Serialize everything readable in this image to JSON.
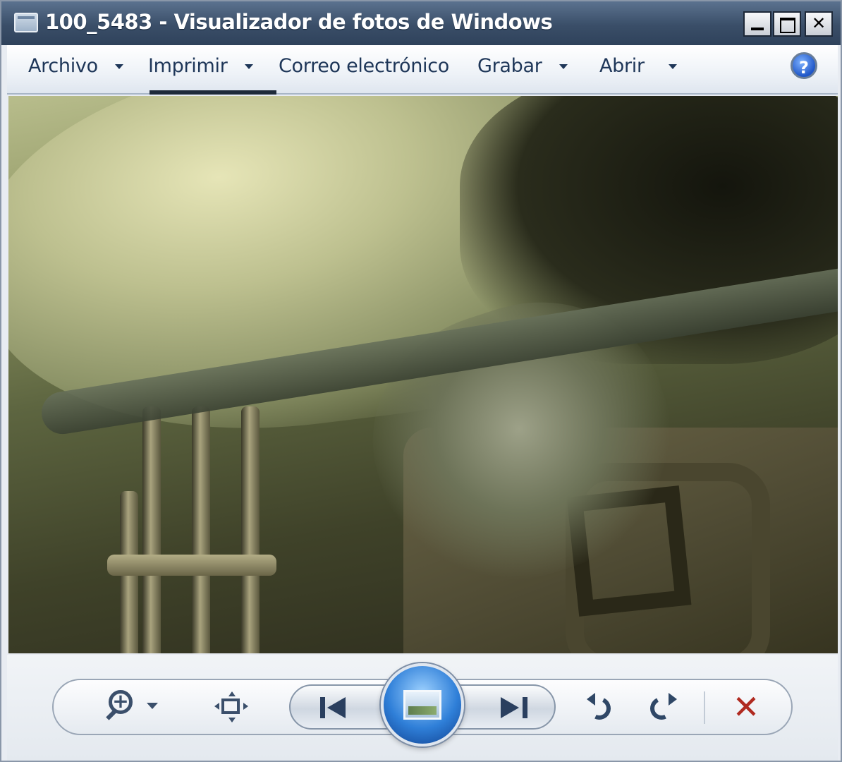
{
  "window": {
    "title": "100_5483 - Visualizador de fotos de Windows",
    "buttons": {
      "minimize": "_",
      "maximize": "□",
      "close": "✕"
    }
  },
  "menubar": {
    "items": [
      {
        "label": "Archivo",
        "has_dropdown": true
      },
      {
        "label": "Imprimir",
        "has_dropdown": true
      },
      {
        "label": "Correo electrónico",
        "has_dropdown": false
      },
      {
        "label": "Grabar",
        "has_dropdown": true
      },
      {
        "label": "Abrir",
        "has_dropdown": true
      }
    ],
    "help_glyph": "?"
  },
  "photo": {
    "icon": "photo-content"
  },
  "controls": {
    "zoom": {
      "icon": "zoom-icon",
      "glyph": "+"
    },
    "fit": {
      "icon": "actual-size-icon"
    },
    "previous": {
      "icon": "previous-icon"
    },
    "slideshow": {
      "icon": "slideshow-icon"
    },
    "next": {
      "icon": "next-icon"
    },
    "rotate_left": {
      "icon": "rotate-counterclockwise-icon"
    },
    "rotate_right": {
      "icon": "rotate-clockwise-icon"
    },
    "delete": {
      "icon": "delete-icon",
      "glyph": "✕",
      "color": "#b02a20"
    }
  }
}
